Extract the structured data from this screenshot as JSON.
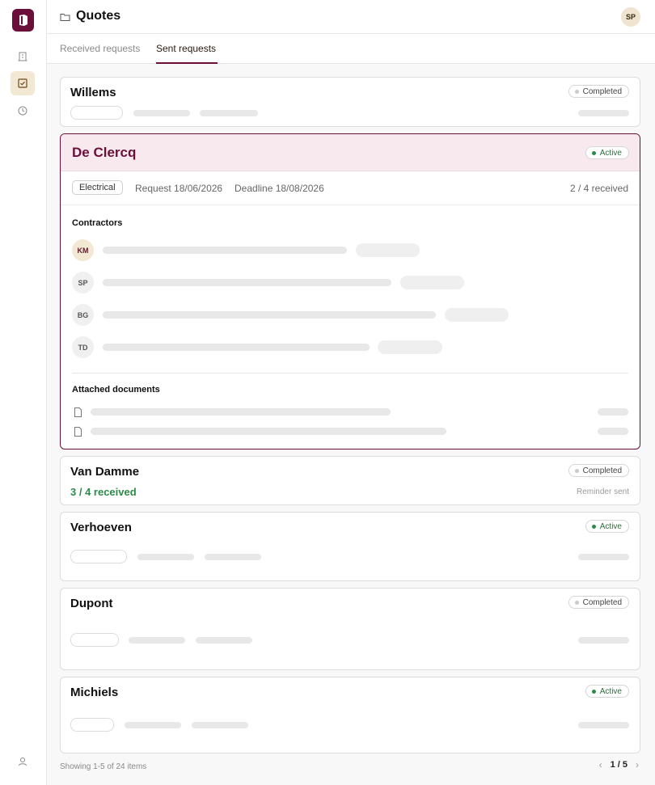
{
  "app": {
    "title": "Quotes",
    "user_initials": "SP"
  },
  "tabs": [
    {
      "label": "Received requests",
      "active": false
    },
    {
      "label": "Sent requests",
      "active": true
    }
  ],
  "cards": [
    {
      "name": "Willems",
      "status": "Completed"
    },
    {
      "name": "De Clercq",
      "status": "Active",
      "category": "Electrical",
      "request": "Request 18/06/2026",
      "deadline": "Deadline 18/08/2026",
      "received": "2 / 4 received",
      "contractors_label": "Contractors",
      "contractors": [
        "KM",
        "SP",
        "BG",
        "TD"
      ],
      "documents_label": "Attached documents"
    },
    {
      "name": "Van Damme",
      "status": "Completed",
      "received": "3 / 4 received",
      "note": "Reminder sent"
    },
    {
      "name": "Verhoeven",
      "status": "Active"
    },
    {
      "name": "Dupont",
      "status": "Completed"
    },
    {
      "name": "Michiels",
      "status": "Active"
    }
  ],
  "footer": {
    "showing": "Showing 1-5 of 24 items",
    "page": "1 / 5",
    "prev_icon": "‹",
    "next_icon": "›"
  },
  "colors": {
    "accent": "#6b0f3a",
    "active_green": "#2e8a4a",
    "highlight": "#f2e8d4"
  }
}
